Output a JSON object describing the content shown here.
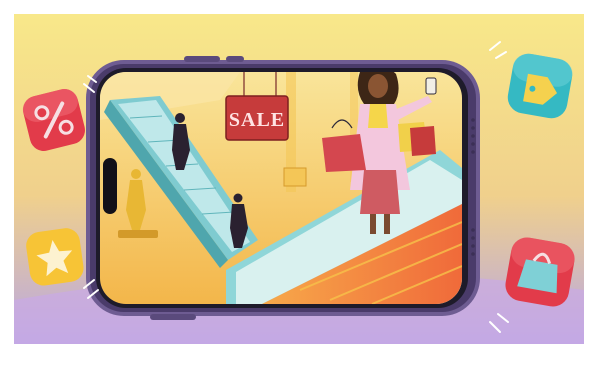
{
  "scene": {
    "sale_sign": "SALE",
    "colors": {
      "bg_top": "#f6e27a",
      "bg_bottom": "#b7a6e4",
      "phone_frame": "#6e5c92",
      "mall_yellow": "#f7c84c",
      "escalator_teal": "#8fd6d8",
      "sale_red": "#c63b3b",
      "shopper_jacket": "#f3c7dd"
    },
    "icons": [
      {
        "name": "percent-icon",
        "color": "#e23b4a"
      },
      {
        "name": "star-icon",
        "color": "#f7c436"
      },
      {
        "name": "price-tag-icon",
        "color": "#35b9c3"
      },
      {
        "name": "shopping-bag-icon",
        "color": "#e23b4a"
      }
    ]
  }
}
